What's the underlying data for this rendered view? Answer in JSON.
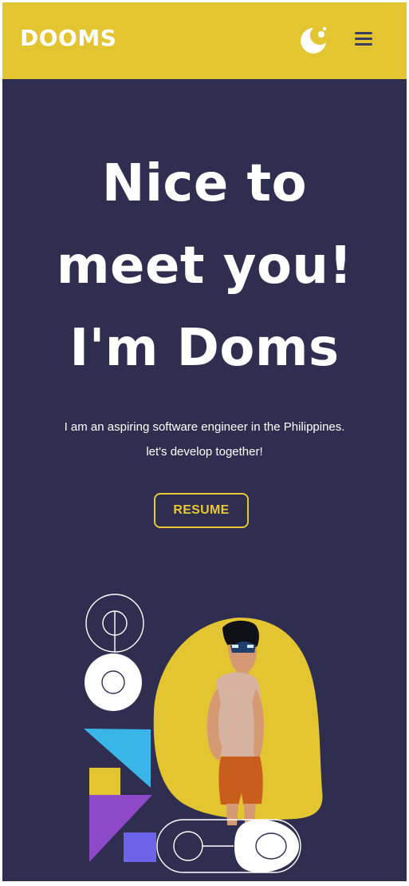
{
  "header": {
    "brand": "DOOMS",
    "icons": {
      "theme": "moon-icon",
      "menu": "hamburger-menu-icon"
    },
    "colors": {
      "bar": "#e2c531",
      "text": "#ffffff"
    }
  },
  "hero": {
    "title_lines": [
      "Nice to",
      "meet you!",
      "I'm Doms"
    ],
    "description_lines": [
      "I am an aspiring software engineer in the Philippines.",
      "let's develop together!"
    ],
    "resume_label": "RESUME",
    "colors": {
      "background": "#2f2e50",
      "accent": "#e7c734"
    }
  },
  "illustration": {
    "subject": "portrait-photo",
    "shapes": [
      "circle",
      "triangle",
      "square",
      "capsule-toggle"
    ]
  }
}
